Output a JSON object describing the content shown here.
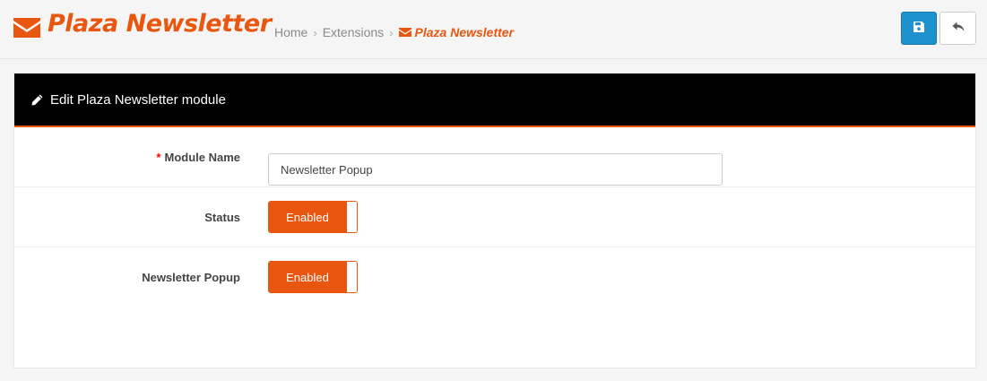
{
  "header": {
    "title": "Plaza Newsletter",
    "title_icon": "envelope-icon",
    "breadcrumb": [
      {
        "label": "Home"
      },
      {
        "label": "Extensions"
      },
      {
        "label": "Plaza Newsletter",
        "icon": "envelope-icon",
        "current": true
      }
    ],
    "buttons": [
      {
        "name": "save-button",
        "icon": "save-icon"
      },
      {
        "name": "back-button",
        "icon": "reply-icon"
      }
    ]
  },
  "panel": {
    "icon": "pencil-icon",
    "title": "Edit Plaza Newsletter module"
  },
  "form": {
    "module_name": {
      "required_mark": "*",
      "label": "Module Name",
      "value": "Newsletter Popup"
    },
    "status": {
      "label": "Status",
      "toggle_label": "Enabled"
    },
    "newsletter_popup": {
      "label": "Newsletter Popup",
      "toggle_label": "Enabled"
    }
  },
  "colors": {
    "accent": "#e8560f",
    "primary_button": "#1e91cf",
    "panel_heading": "#000000",
    "required": "#ff0000"
  }
}
